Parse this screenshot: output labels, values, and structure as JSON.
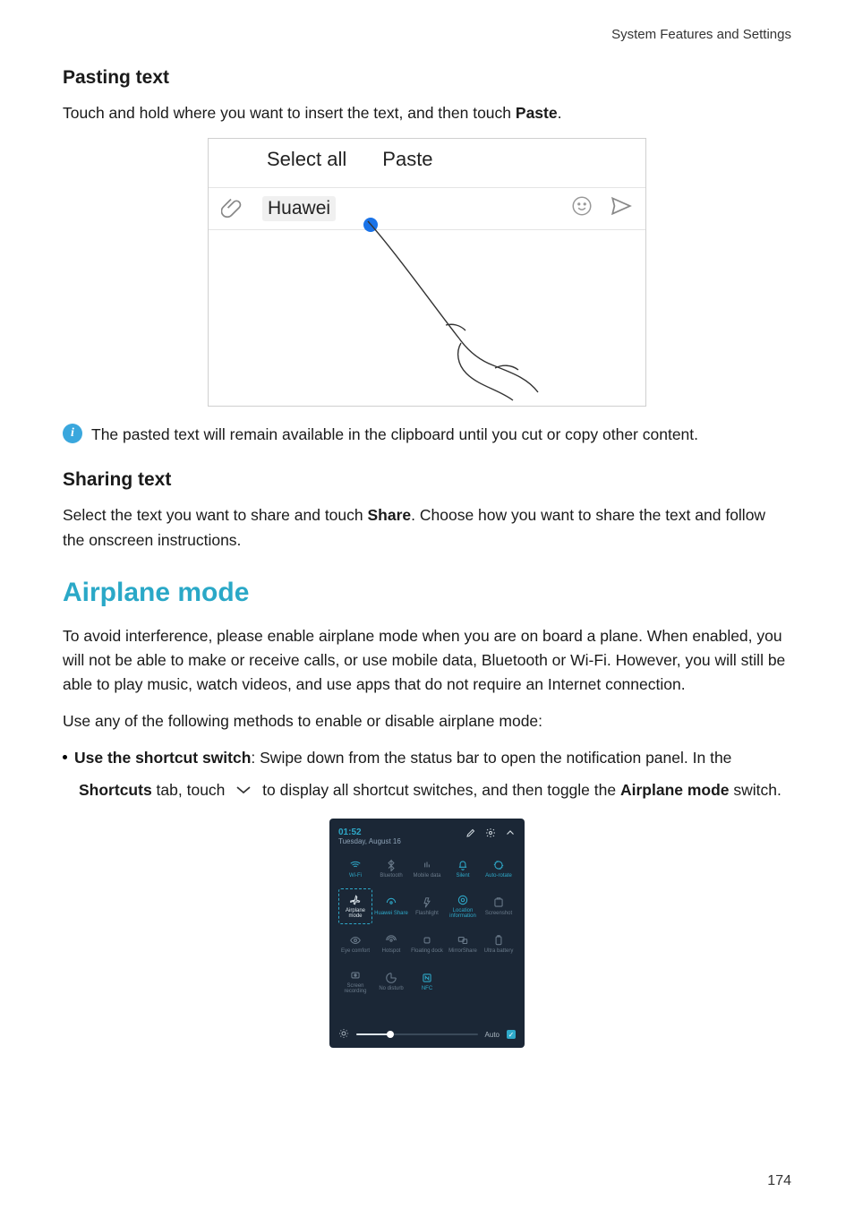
{
  "header": {
    "breadcrumb": "System Features and Settings"
  },
  "section_pasting": {
    "heading": "Pasting text",
    "body_pre": "Touch and hold where you want to insert the text, and then touch ",
    "body_bold": "Paste",
    "body_post": "."
  },
  "paste_menu": {
    "select_all": "Select all",
    "paste": "Paste",
    "input_value": "Huawei"
  },
  "info_note": {
    "text": "The pasted text will remain available in the clipboard until you cut or copy other content."
  },
  "section_sharing": {
    "heading": "Sharing text",
    "body_pre": "Select the text you want to share and touch ",
    "body_bold": "Share",
    "body_post": ". Choose how you want to share the text and follow the onscreen instructions."
  },
  "section_airplane": {
    "heading": "Airplane mode",
    "para1": "To avoid interference, please enable airplane mode when you are on board a plane. When enabled, you will not be able to make or receive calls, or use mobile data, Bluetooth or Wi-Fi. However, you will still be able to play music, watch videos, and use apps that do not require an Internet connection.",
    "para2": "Use any of the following methods to enable or disable airplane mode:",
    "bullet1_bold": "Use the shortcut switch",
    "bullet1_rest": ": Swipe down from the status bar to open the notification panel. In the",
    "bullet1_line2_bold1": "Shortcuts",
    "bullet1_line2_mid": " tab, touch ",
    "bullet1_line2_rest": " to display all shortcut switches, and then toggle the ",
    "bullet1_line2_bold2": "Airplane mode",
    "bullet1_line2_end": " switch."
  },
  "phone_panel": {
    "time": "01:52",
    "date": "Tuesday, August 16",
    "tiles": [
      {
        "label": "Wi-Fi",
        "glyph": "wifi",
        "state": "active"
      },
      {
        "label": "Bluetooth",
        "glyph": "bt",
        "state": "dim"
      },
      {
        "label": "Mobile data",
        "glyph": "data",
        "state": "dim"
      },
      {
        "label": "Silent",
        "glyph": "bell",
        "state": "active"
      },
      {
        "label": "Auto-rotate",
        "glyph": "rotate",
        "state": "active"
      },
      {
        "label": "Airplane mode",
        "glyph": "plane",
        "state": "dashed"
      },
      {
        "label": "Huawei Share",
        "glyph": "share",
        "state": "active"
      },
      {
        "label": "Flashlight",
        "glyph": "flash",
        "state": "dim"
      },
      {
        "label": "Location information",
        "glyph": "loc",
        "state": "active"
      },
      {
        "label": "Screenshot",
        "glyph": "shot",
        "state": "dim"
      },
      {
        "label": "Eye comfort",
        "glyph": "eye",
        "state": "dim"
      },
      {
        "label": "Hotspot",
        "glyph": "hotspot",
        "state": "dim"
      },
      {
        "label": "Floating dock",
        "glyph": "dock",
        "state": "dim"
      },
      {
        "label": "MirrorShare",
        "glyph": "mirror",
        "state": "dim"
      },
      {
        "label": "Ultra battery",
        "glyph": "batt",
        "state": "dim"
      },
      {
        "label": "Screen recording",
        "glyph": "rec",
        "state": "dim"
      },
      {
        "label": "No disturb",
        "glyph": "dnd",
        "state": "dim"
      },
      {
        "label": "NFC",
        "glyph": "nfc",
        "state": "active"
      }
    ],
    "auto_label": "Auto"
  },
  "page_number": "174"
}
